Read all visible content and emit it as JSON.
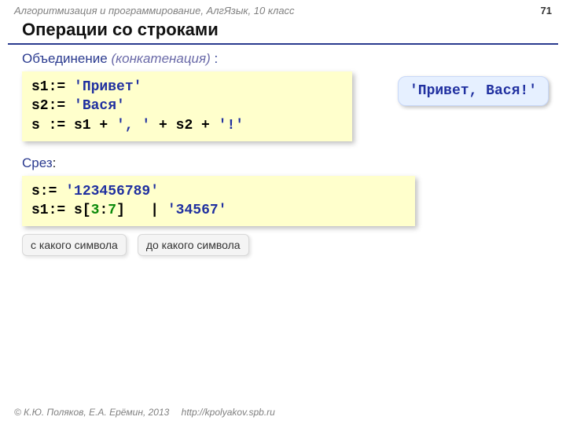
{
  "header": {
    "course": "Алгоритмизация и программирование, АлгЯзык, 10 класс",
    "page": "71"
  },
  "title": "Операции со строками",
  "section1": {
    "label_main": "Объединение",
    "label_paren": "(конкатенация)",
    "label_colon": " :",
    "code_l1_a": "s1:= ",
    "code_l1_b": "'Привет'",
    "code_l2_a": "s2:= ",
    "code_l2_b": "'Вася'",
    "code_l3_a": "s := s1 + ",
    "code_l3_b": "', '",
    "code_l3_c": " + s2 + ",
    "code_l3_d": "'!'",
    "bubble": "'Привет, Вася!'"
  },
  "section2": {
    "label": "Срез",
    "label_colon": ":",
    "code_l1_a": "s:= ",
    "code_l1_b": "'123456789'",
    "code_l2_a": "s1:= s[",
    "code_l2_b": "3",
    "code_l2_c": ":",
    "code_l2_d": "7",
    "code_l2_e": "]   | ",
    "code_l2_f": "'34567'",
    "label_from": "с какого символа",
    "label_to": "до какого символа"
  },
  "footer": {
    "copyright": "© К.Ю. Поляков, Е.А. Ерёмин, 2013",
    "url": "http://kpolyakov.spb.ru"
  }
}
